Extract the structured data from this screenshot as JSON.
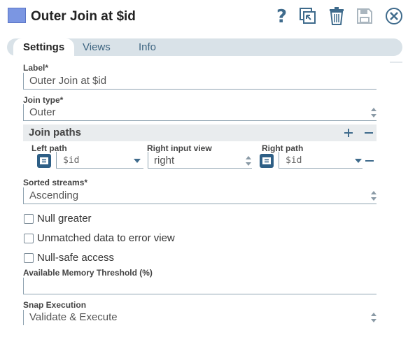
{
  "header": {
    "title": "Outer Join at $id",
    "icons": [
      "help-icon",
      "copy-window-icon",
      "trash-icon",
      "save-icon",
      "close-icon"
    ]
  },
  "tabs": [
    {
      "label": "Settings",
      "active": true
    },
    {
      "label": "Views",
      "active": false
    },
    {
      "label": "Info",
      "active": false
    }
  ],
  "form": {
    "label_label": "Label*",
    "label_value": "Outer Join at $id",
    "join_type_label": "Join type*",
    "join_type_value": "Outer",
    "join_paths_title": "Join paths",
    "left_path_label": "Left path",
    "left_path_value": "$id",
    "right_input_view_label": "Right input view",
    "right_input_view_value": "right",
    "right_path_label": "Right path",
    "right_path_value": "$id",
    "sorted_streams_label": "Sorted streams*",
    "sorted_streams_value": "Ascending",
    "null_greater_label": "Null greater",
    "unmatched_label": "Unmatched data to error view",
    "null_safe_label": "Null-safe access",
    "memory_threshold_label": "Available Memory Threshold (%)",
    "memory_threshold_value": "",
    "snap_execution_label": "Snap Execution",
    "snap_execution_value": "Validate & Execute"
  },
  "colors": {
    "accent": "#2e5f86",
    "header_icon": "#7b96e2",
    "tab_bar": "#d9e2e8"
  }
}
